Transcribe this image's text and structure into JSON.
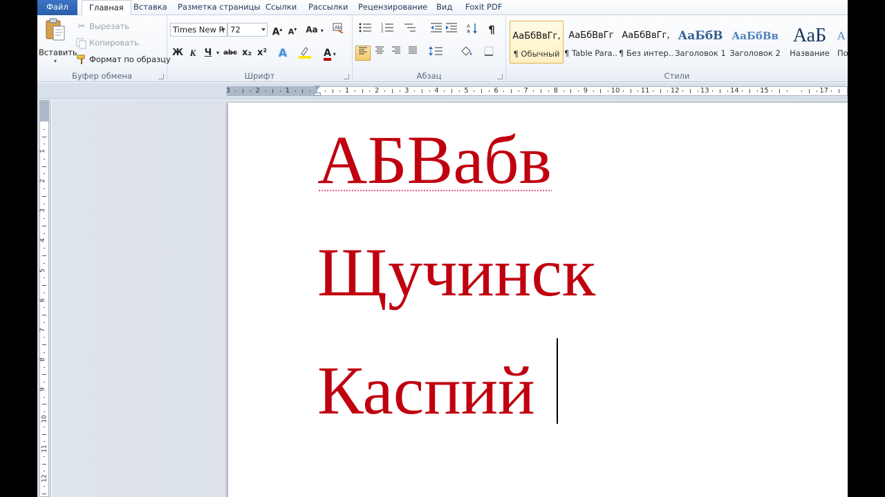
{
  "tabs": [
    {
      "label": "Файл"
    },
    {
      "label": "Главная"
    },
    {
      "label": "Вставка"
    },
    {
      "label": "Разметка страницы"
    },
    {
      "label": "Ссылки"
    },
    {
      "label": "Рассылки"
    },
    {
      "label": "Рецензирование"
    },
    {
      "label": "Вид"
    },
    {
      "label": "Foxit PDF"
    }
  ],
  "clipboard": {
    "paste": "Вставить",
    "cut": "Вырезать",
    "copy": "Копировать",
    "format_painter": "Формат по образцу",
    "group_label": "Буфер обмена"
  },
  "font": {
    "name": "Times New R",
    "size": "72",
    "grow": "A",
    "shrink": "A",
    "case": "Aa",
    "bold": "Ж",
    "italic": "К",
    "underline": "Ч",
    "strike": "abc",
    "subscript": "x₂",
    "superscript": "x²",
    "effects": "A",
    "font_color": "A",
    "group_label": "Шрифт"
  },
  "paragraph": {
    "pilcrow": "¶",
    "group_label": "Абзац"
  },
  "styles": {
    "items": [
      {
        "sample": "АаБбВвГг,",
        "name": "¶ Обычный"
      },
      {
        "sample": "АаБбВвГг",
        "name": "¶ Table Para..."
      },
      {
        "sample": "АаБбВвГг,",
        "name": "¶ Без интер..."
      },
      {
        "sample": "АаБбВ",
        "name": "Заголовок 1"
      },
      {
        "sample": "АаБбВв",
        "name": "Заголовок 2"
      },
      {
        "sample": "АаБ",
        "name": "Название"
      },
      {
        "sample": "А",
        "name": "По"
      }
    ],
    "group_label": "Стили"
  },
  "ruler": {
    "corner": "L",
    "h_left_labels": [
      "3",
      "2",
      "1"
    ],
    "h_labels": [
      "1",
      "2",
      "3",
      "4",
      "5",
      "6",
      "7",
      "8",
      "9",
      "10",
      "11",
      "12",
      "13",
      "14",
      "15",
      "17"
    ],
    "v_labels": [
      "1",
      "2",
      "3",
      "4",
      "5",
      "6",
      "7",
      "8",
      "9",
      "10",
      "11",
      "12"
    ]
  },
  "document": {
    "lines": [
      "АБВабв",
      "Щучинск",
      "Каспий"
    ],
    "text_color": "#c0000f"
  },
  "colors": {
    "accent": "#2a5da8",
    "highlight": "#ffe600",
    "font_color_bar": "#c00000"
  }
}
